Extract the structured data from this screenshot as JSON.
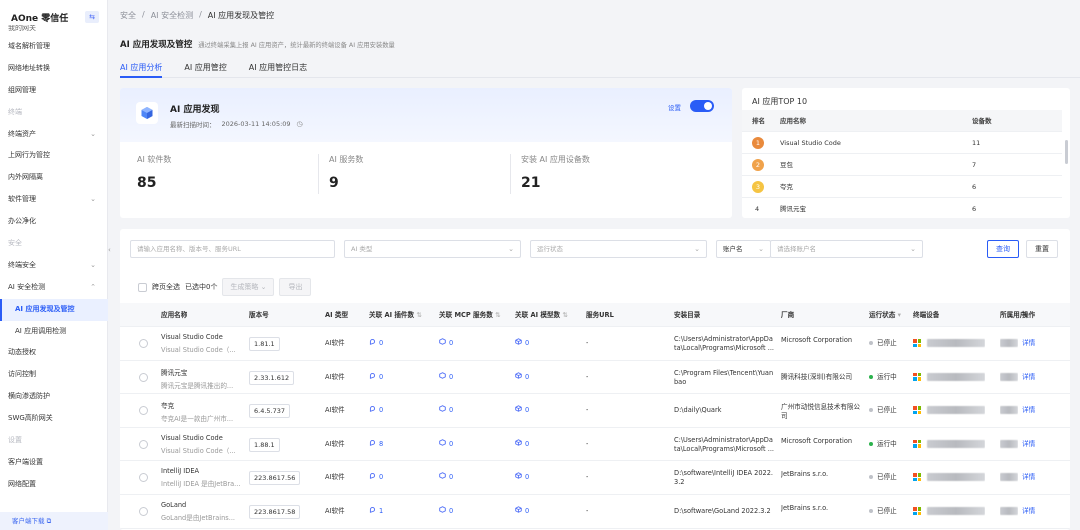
{
  "app": {
    "brand": "AOne 零信任",
    "collapse_icon": "⇆"
  },
  "sidebar": {
    "items": [
      {
        "label": "我的网关",
        "type": "cut"
      },
      {
        "label": "域名解析管理",
        "type": "item"
      },
      {
        "label": "网络地址转换",
        "type": "item"
      },
      {
        "label": "组网管理",
        "type": "item"
      },
      {
        "label": "终端",
        "type": "group"
      },
      {
        "label": "终端资产",
        "type": "item",
        "chevron": true
      },
      {
        "label": "上网行为管控",
        "type": "item"
      },
      {
        "label": "内外网隔离",
        "type": "item"
      },
      {
        "label": "软件管理",
        "type": "item",
        "chevron": true
      },
      {
        "label": "办公净化",
        "type": "item"
      },
      {
        "label": "安全",
        "type": "group"
      },
      {
        "label": "终端安全",
        "type": "item",
        "chevron": true
      },
      {
        "label": "AI 安全检测",
        "type": "item",
        "chevron": true,
        "open": true
      },
      {
        "label": "AI 应用发现及管控",
        "type": "sub",
        "active": true
      },
      {
        "label": "AI 应用调用检测",
        "type": "sub"
      },
      {
        "label": "动态授权",
        "type": "item"
      },
      {
        "label": "访问控制",
        "type": "item"
      },
      {
        "label": "横向渗透防护",
        "type": "item"
      },
      {
        "label": "SWG高阶网关",
        "type": "item"
      },
      {
        "label": "设置",
        "type": "group"
      },
      {
        "label": "客户端设置",
        "type": "item"
      },
      {
        "label": "网络配置",
        "type": "item"
      }
    ],
    "footer_link": "客户端下载 ⧉"
  },
  "breadcrumb": [
    "安全",
    "/",
    "AI 安全检测",
    "/",
    "AI 应用发现及管控"
  ],
  "header": {
    "title": "AI 应用发现及管控",
    "description": "通过终端采集上报 AI 应用资产，统计最新的终端设备 AI 应用安装数量"
  },
  "tabs": [
    {
      "label": "AI 应用分析",
      "active": true
    },
    {
      "label": "AI 应用管控",
      "active": false
    },
    {
      "label": "AI 应用管控日志",
      "active": false
    }
  ],
  "discovery": {
    "title": "AI 应用发现",
    "scan_label": "最新扫描时间：",
    "scan_time": "2026-03-11 14:05:09",
    "settings_label": "设置",
    "toggle_on": true,
    "stats": [
      {
        "label": "AI 软件数",
        "value": "85"
      },
      {
        "label": "AI 服务数",
        "value": "9"
      },
      {
        "label": "安装 AI 应用设备数",
        "value": "21"
      }
    ]
  },
  "top10": {
    "title": "AI 应用TOP 10",
    "columns": [
      "排名",
      "应用名称",
      "设备数"
    ],
    "rows": [
      {
        "rank": "1",
        "name": "Visual Studio Code",
        "count": "11",
        "color": "#e98a3c"
      },
      {
        "rank": "2",
        "name": "豆包",
        "count": "7",
        "color": "#f0a24b"
      },
      {
        "rank": "3",
        "name": "夸克",
        "count": "6",
        "color": "#f5c443"
      },
      {
        "rank": "4",
        "name": "腾讯元宝",
        "count": "6",
        "color": ""
      }
    ]
  },
  "filters": {
    "search_placeholder": "请输入应用名称、版本号、服务URL",
    "ai_type_placeholder": "AI 类型",
    "status_placeholder": "运行状态",
    "account_select": "账户名",
    "account_placeholder": "请选择账户名",
    "query_label": "查询",
    "reset_label": "重置"
  },
  "selection": {
    "select_all_label": "跨页全选",
    "selected_text": "已选中0个",
    "generate_label": "生成策略",
    "export_label": "导出"
  },
  "table": {
    "columns": [
      "应用名称",
      "版本号",
      "AI 类型",
      "关联 AI 插件数",
      "关联 MCP 服务数",
      "关联 AI 模型数",
      "服务URL",
      "安装目录",
      "厂商",
      "运行状态",
      "终端设备",
      "所属用户",
      "操作"
    ],
    "rows": [
      {
        "name": "Visual Studio Code",
        "desc": "Visual Studio Code（...",
        "version": "1.81.1",
        "type": "AI软件",
        "plugins": "0",
        "mcp": "0",
        "models": "0",
        "url": "-",
        "dir": [
          "C:\\Users\\Administrator\\AppDa",
          "ta\\Local\\Programs\\Microsoft ..."
        ],
        "vendor": "Microsoft Corporation",
        "status": "已停止",
        "status_color": "#bfc2c8",
        "action": "详情"
      },
      {
        "name": "腾讯元宝",
        "desc": "腾讯元宝是腾讯推出的...",
        "version": "2.33.1.612",
        "type": "AI软件",
        "plugins": "0",
        "mcp": "0",
        "models": "0",
        "url": "-",
        "dir": [
          "C:\\Program Files\\Tencent\\Yuan",
          "bao"
        ],
        "vendor": "腾讯科技(深圳)有限公司",
        "status": "运行中",
        "status_color": "#2bb24c",
        "action": "详情"
      },
      {
        "name": "夸克",
        "desc": "夸克AI是一款由广州市...",
        "version": "6.4.5.737",
        "type": "AI软件",
        "plugins": "0",
        "mcp": "0",
        "models": "0",
        "url": "-",
        "dir": [
          "D:\\daily\\Quark"
        ],
        "vendor": "广州市动悦信息技术有限公司",
        "status": "已停止",
        "status_color": "#bfc2c8",
        "action": "详情"
      },
      {
        "name": "Visual Studio Code",
        "desc": "Visual Studio Code（...",
        "version": "1.88.1",
        "type": "AI软件",
        "plugins": "8",
        "mcp": "0",
        "models": "0",
        "url": "-",
        "dir": [
          "C:\\Users\\Administrator\\AppDa",
          "ta\\Local\\Programs\\Microsoft ..."
        ],
        "vendor": "Microsoft Corporation",
        "status": "运行中",
        "status_color": "#2bb24c",
        "action": "详情"
      },
      {
        "name": "IntelliJ IDEA",
        "desc": "IntelliJ IDEA 是由JetBra...",
        "version": "223.8617.56",
        "type": "AI软件",
        "plugins": "0",
        "mcp": "0",
        "models": "0",
        "url": "-",
        "dir": [
          "D:\\software\\IntelliJ IDEA 2022.",
          "3.2"
        ],
        "vendor": "JetBrains s.r.o.",
        "status": "已停止",
        "status_color": "#bfc2c8",
        "action": "详情"
      },
      {
        "name": "GoLand",
        "desc": "GoLand是由JetBrains...",
        "version": "223.8617.58",
        "type": "AI软件",
        "plugins": "1",
        "mcp": "0",
        "models": "0",
        "url": "-",
        "dir": [
          "D:\\software\\GoLand 2022.3.2"
        ],
        "vendor": "JetBrains s.r.o.",
        "status": "已停止",
        "status_color": "#bfc2c8",
        "action": "详情"
      }
    ]
  },
  "colors": {
    "accent": "#2a5cf6",
    "running": "#2bb24c",
    "stopped": "#bfc2c8"
  }
}
